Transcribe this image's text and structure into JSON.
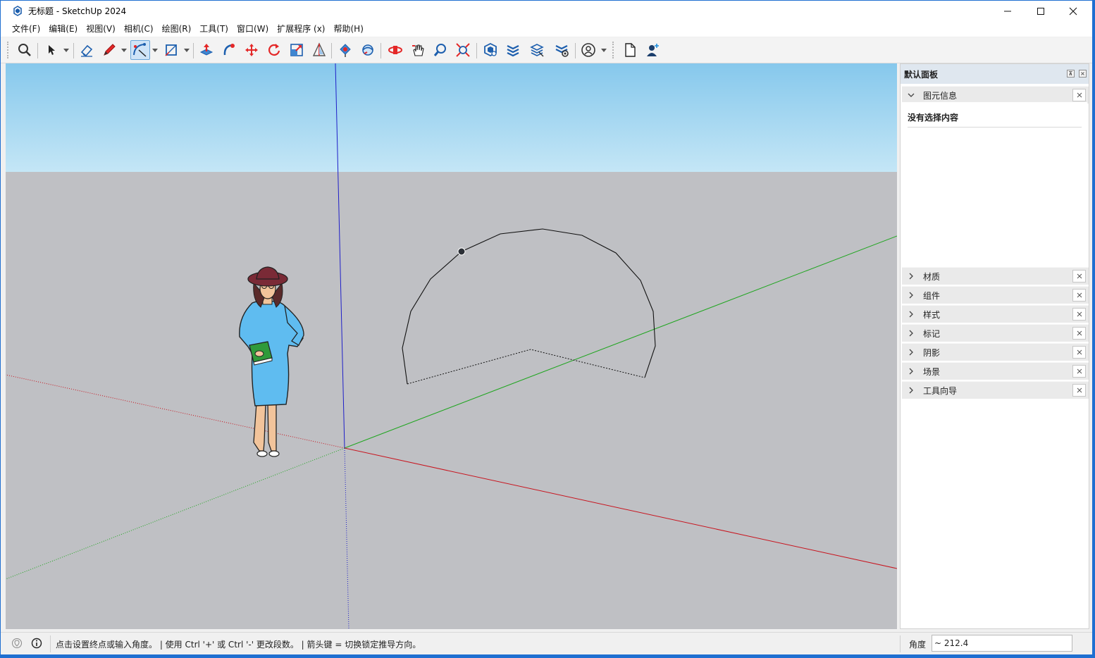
{
  "window": {
    "title": "无标题 - SketchUp 2024"
  },
  "menu": [
    "文件(F)",
    "编辑(E)",
    "视图(V)",
    "相机(C)",
    "绘图(R)",
    "工具(T)",
    "窗口(W)",
    "扩展程序 (x)",
    "帮助(H)"
  ],
  "toolbar": {
    "icons": [
      "search-icon",
      "select-icon",
      "eraser-icon",
      "pencil-icon",
      "arc-icon",
      "rectangle-icon",
      "push-pull-icon",
      "follow-me-icon",
      "move-icon",
      "rotate-icon",
      "scale-icon",
      "section-plane-icon",
      "paint-bucket-icon",
      "orbit-icon",
      "pan-icon",
      "zoom-icon",
      "zoom-extents-icon",
      "warehouse-icon",
      "extension-warehouse-icon",
      "layout-icon",
      "extension-manager-icon",
      "account-icon",
      "new-file-icon",
      "add-user-icon"
    ],
    "active_tool": "arc-icon"
  },
  "tray": {
    "title": "默认面板",
    "entity_info": {
      "label": "图元信息",
      "empty_text": "没有选择内容"
    },
    "sections": [
      "材质",
      "组件",
      "样式",
      "标记",
      "阴影",
      "场景",
      "工具向导"
    ]
  },
  "status": {
    "hint": "点击设置终点或输入角度。 | 使用 Ctrl '+' 或 Ctrl '-' 更改段数。 | 箭头键 = 切换锁定推导方向。",
    "measure_label": "角度",
    "measure_value": "~ 212.4"
  },
  "colors": {
    "sky_top": "#86c8ec",
    "sky_bottom": "#c4e6f6",
    "ground": "#bfc0c4",
    "axis_red": "#c8141e",
    "axis_green": "#1ea51e",
    "axis_blue": "#1e1ec8",
    "tray_header": "#dfe7ef"
  }
}
